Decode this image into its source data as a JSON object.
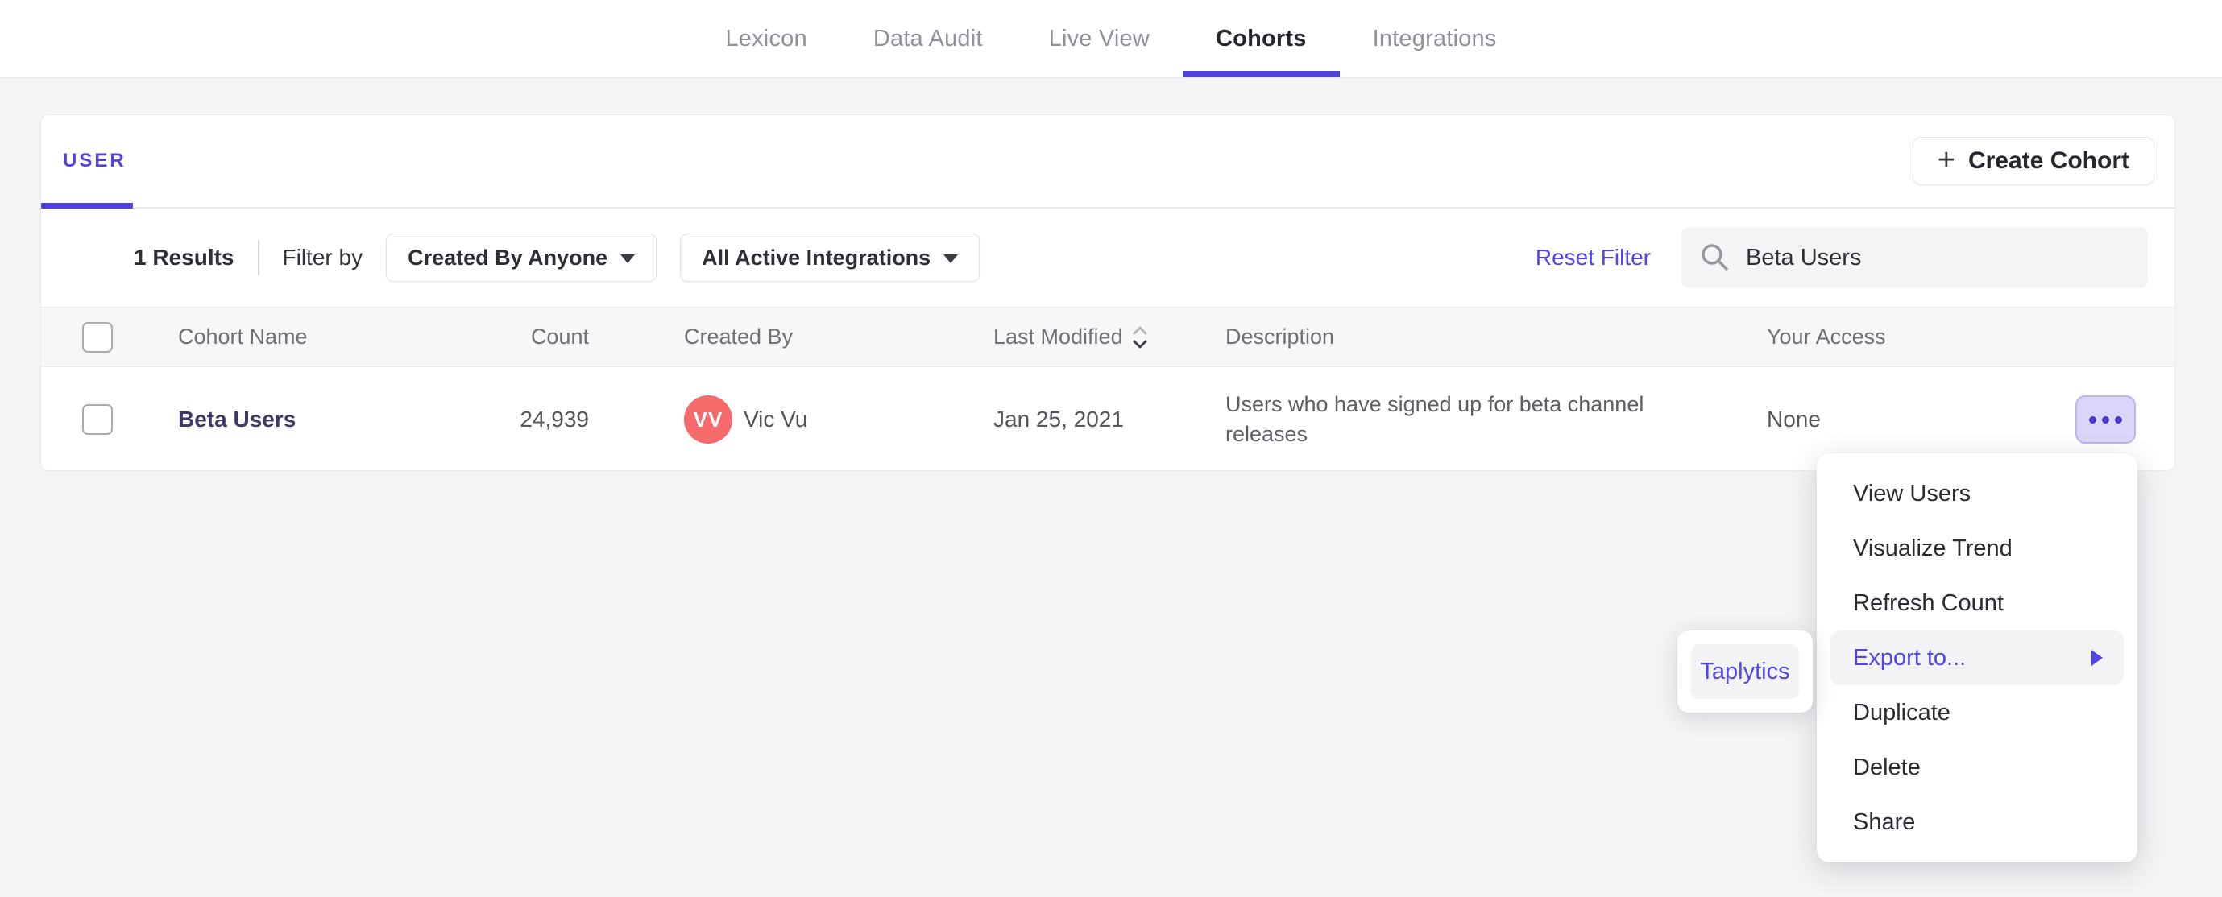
{
  "nav": {
    "tabs": [
      {
        "label": "Lexicon",
        "active": false
      },
      {
        "label": "Data Audit",
        "active": false
      },
      {
        "label": "Live View",
        "active": false
      },
      {
        "label": "Cohorts",
        "active": true
      },
      {
        "label": "Integrations",
        "active": false
      }
    ]
  },
  "panel": {
    "tab_label": "USER",
    "create_button_label": "Create Cohort",
    "create_button_icon": "plus-icon",
    "filters": {
      "results_count": "1 Results",
      "filter_by_label": "Filter by",
      "created_by_dropdown": "Created By Anyone",
      "integrations_dropdown": "All Active Integrations",
      "reset_label": "Reset Filter",
      "search": {
        "icon": "search-icon",
        "value": "Beta Users",
        "placeholder": ""
      }
    },
    "table": {
      "columns": [
        "Cohort Name",
        "Count",
        "Created By",
        "Last Modified",
        "Description",
        "Your Access"
      ],
      "sorted_column": "Last Modified",
      "rows": [
        {
          "name": "Beta Users",
          "count": "24,939",
          "created_by": {
            "initials": "VV",
            "name": "Vic Vu",
            "avatar_color": "#f56a6a"
          },
          "last_modified": "Jan 25, 2021",
          "description": "Users who have signed up for beta channel releases",
          "access": "None",
          "actions_icon": "ellipsis-icon"
        }
      ]
    }
  },
  "context_menu": {
    "items": [
      {
        "label": "View Users",
        "highlighted": false
      },
      {
        "label": "Visualize Trend",
        "highlighted": false
      },
      {
        "label": "Refresh Count",
        "highlighted": false
      },
      {
        "label": "Export to...",
        "highlighted": true,
        "has_submenu": true
      },
      {
        "label": "Duplicate",
        "highlighted": false
      },
      {
        "label": "Delete",
        "highlighted": false
      },
      {
        "label": "Share",
        "highlighted": false
      }
    ]
  },
  "submenu": {
    "items": [
      {
        "label": "Taplytics"
      }
    ]
  },
  "colors": {
    "accent": "#5143da",
    "link": "#5246e0",
    "avatar": "#f56a6a",
    "page_bg": "#f4f4f6",
    "header_bg": "#f7f7f9",
    "more_button_bg": "#dad6f7"
  }
}
